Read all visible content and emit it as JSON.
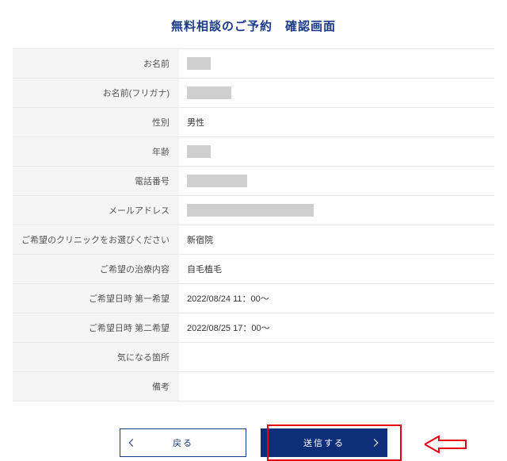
{
  "title": "無料相談のご予約　確認画面",
  "fields": [
    {
      "label": "お名前",
      "kind": "masked",
      "maskClass": "w-small"
    },
    {
      "label": "お名前(フリガナ)",
      "kind": "masked",
      "maskClass": "w-med"
    },
    {
      "label": "性別",
      "kind": "text",
      "value": "男性"
    },
    {
      "label": "年齢",
      "kind": "masked",
      "maskClass": "w-age"
    },
    {
      "label": "電話番号",
      "kind": "masked",
      "maskClass": "w-phone"
    },
    {
      "label": "メールアドレス",
      "kind": "masked",
      "maskClass": "w-email"
    },
    {
      "label": "ご希望のクリニックをお選びください",
      "kind": "text",
      "value": "新宿院"
    },
    {
      "label": "ご希望の治療内容",
      "kind": "text",
      "value": "自毛植毛"
    },
    {
      "label": "ご希望日時 第一希望",
      "kind": "text",
      "value": "2022/08/24 11：00～"
    },
    {
      "label": "ご希望日時 第二希望",
      "kind": "text",
      "value": "2022/08/25 17：00～"
    },
    {
      "label": "気になる箇所",
      "kind": "text",
      "value": ""
    },
    {
      "label": "備考",
      "kind": "text",
      "value": ""
    }
  ],
  "buttons": {
    "back": "戻る",
    "submit": "送信する"
  }
}
